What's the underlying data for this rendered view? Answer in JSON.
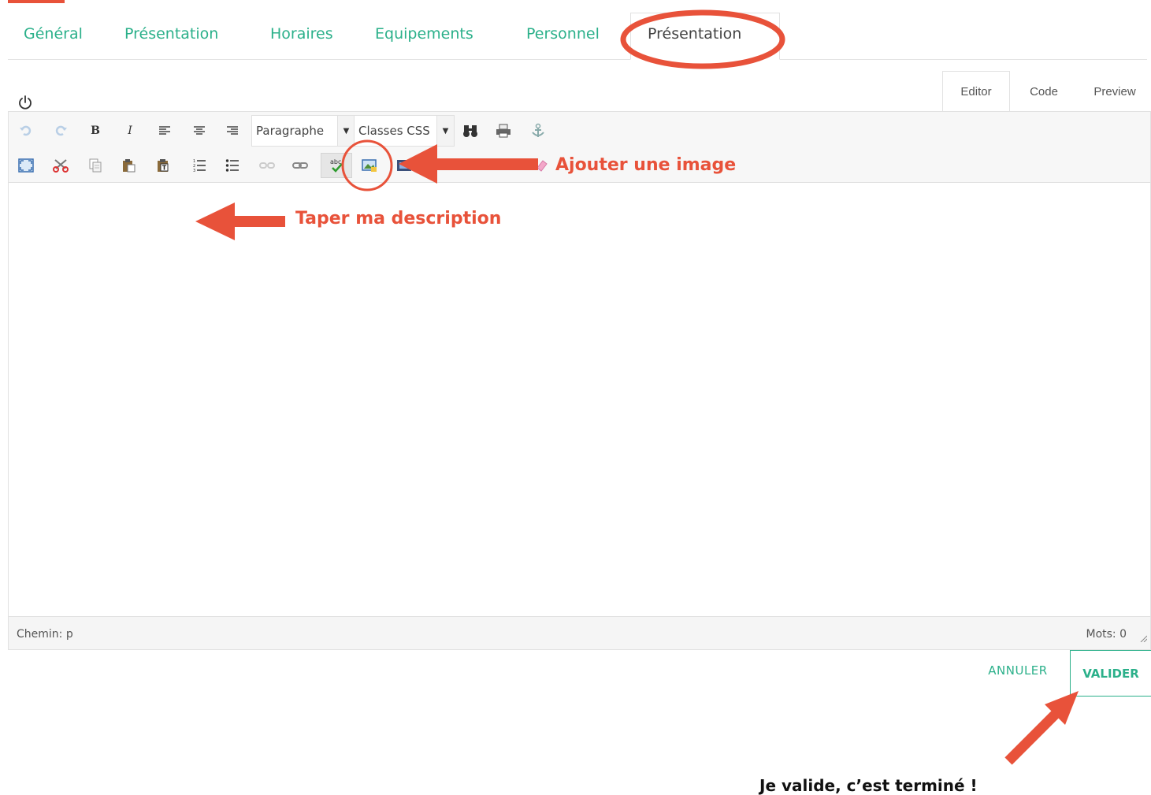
{
  "tabs": [
    {
      "label": "Général",
      "active": false
    },
    {
      "label": "Présentation",
      "active": false
    },
    {
      "label": "Horaires",
      "active": false
    },
    {
      "label": "Equipements",
      "active": false
    },
    {
      "label": "Personnel",
      "active": false
    },
    {
      "label": "Présentation",
      "active": true
    }
  ],
  "editor_modes": {
    "editor": "Editor",
    "code": "Code",
    "preview": "Preview",
    "active": "Editor"
  },
  "toolbar": {
    "row1": [
      "undo-icon",
      "redo-icon",
      "bold-icon",
      "italic-icon",
      "align-left-icon",
      "align-center-icon",
      "align-right-icon",
      "find-icon",
      "print-icon",
      "anchor-icon"
    ],
    "bold_label": "B",
    "italic_label": "I",
    "format_select": "Paragraphe",
    "class_select": "Classes CSS",
    "row2": [
      "fullscreen-icon",
      "cut-icon",
      "copy-icon",
      "paste-icon",
      "paste-text-icon",
      "ordered-list-icon",
      "unordered-list-icon",
      "unlink-icon",
      "link-icon",
      "spellcheck-icon",
      "insert-image-icon",
      "media-icon",
      "eraser-icon"
    ],
    "spellcheck_label": "abc"
  },
  "statusbar": {
    "path": "Chemin: p",
    "words": "Mots: 0"
  },
  "buttons": {
    "cancel": "ANNULER",
    "validate": "VALIDER"
  },
  "annotations": {
    "add_image": "Ajouter une image",
    "type_description": "Taper ma description",
    "validate_done": "Je valide, c’est terminé !"
  },
  "colors": {
    "accent_green": "#2bb08a",
    "annotation_red": "#e8523a"
  }
}
